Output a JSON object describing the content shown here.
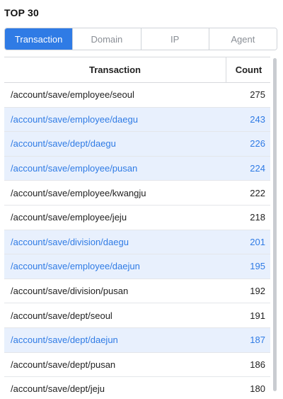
{
  "title": "TOP 30",
  "tabs": [
    {
      "label": "Transaction",
      "active": true
    },
    {
      "label": "Domain",
      "active": false
    },
    {
      "label": "IP",
      "active": false
    },
    {
      "label": "Agent",
      "active": false
    }
  ],
  "table": {
    "headers": {
      "transaction": "Transaction",
      "count": "Count"
    },
    "rows": [
      {
        "transaction": "/account/save/employee/seoul",
        "count": "275",
        "highlighted": false
      },
      {
        "transaction": "/account/save/employee/daegu",
        "count": "243",
        "highlighted": true
      },
      {
        "transaction": "/account/save/dept/daegu",
        "count": "226",
        "highlighted": true
      },
      {
        "transaction": "/account/save/employee/pusan",
        "count": "224",
        "highlighted": true
      },
      {
        "transaction": "/account/save/employee/kwangju",
        "count": "222",
        "highlighted": false
      },
      {
        "transaction": "/account/save/employee/jeju",
        "count": "218",
        "highlighted": false
      },
      {
        "transaction": "/account/save/division/daegu",
        "count": "201",
        "highlighted": true
      },
      {
        "transaction": "/account/save/employee/daejun",
        "count": "195",
        "highlighted": true
      },
      {
        "transaction": "/account/save/division/pusan",
        "count": "192",
        "highlighted": false
      },
      {
        "transaction": "/account/save/dept/seoul",
        "count": "191",
        "highlighted": false
      },
      {
        "transaction": "/account/save/dept/daejun",
        "count": "187",
        "highlighted": true
      },
      {
        "transaction": "/account/save/dept/pusan",
        "count": "186",
        "highlighted": false
      },
      {
        "transaction": "/account/save/dept/jeju",
        "count": "180",
        "highlighted": false
      }
    ]
  },
  "colors": {
    "accent": "#2f7be5",
    "highlight_row_bg": "#e8f0fd",
    "border": "#d7d9dd",
    "tab_inactive_text": "#8a8f96"
  }
}
